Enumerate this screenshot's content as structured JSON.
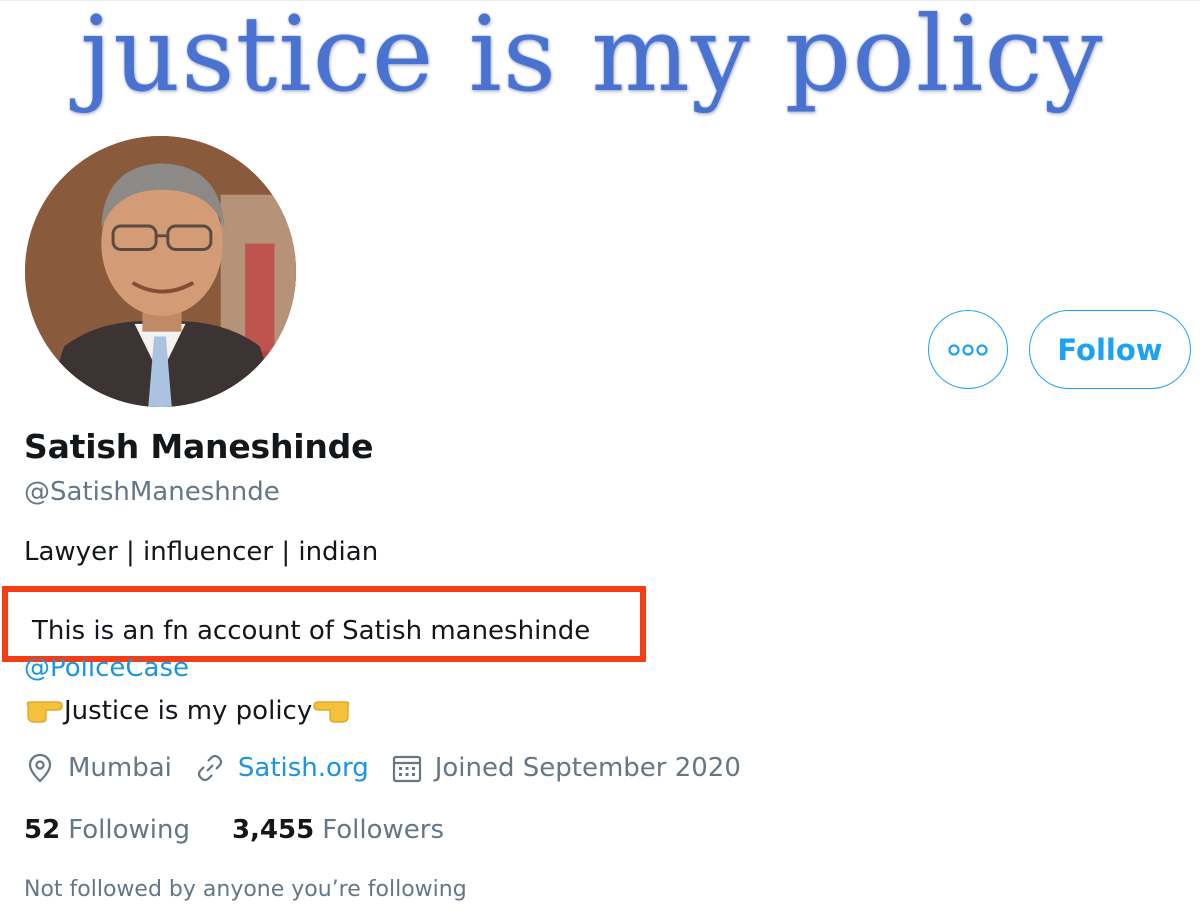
{
  "banner": {
    "text": "justice is my policy",
    "color": "#4a72d1"
  },
  "profile": {
    "name": "Satish Maneshinde",
    "handle": "@SatishManeshnde",
    "bio_line1": "Lawyer | influencer | indian",
    "bio_line2": "This is an fn account of Satish maneshinde",
    "mention": "@PoliceCase",
    "bio_line3": "Justice is my policy"
  },
  "actions": {
    "more_icon": "more-dots-icon",
    "follow_label": "Follow"
  },
  "meta": {
    "location": "Mumbai",
    "website": "Satish.org",
    "joined": "Joined September 2020"
  },
  "stats": {
    "following_count": "52",
    "following_label": "Following",
    "followers_count": "3,455",
    "followers_label": "Followers"
  },
  "footer": {
    "not_followed": "Not followed by anyone you’re following"
  },
  "colors": {
    "accent": "#1da1f2",
    "link": "#1b95e0",
    "muted": "#657786",
    "highlight_border": "#f43d14"
  }
}
